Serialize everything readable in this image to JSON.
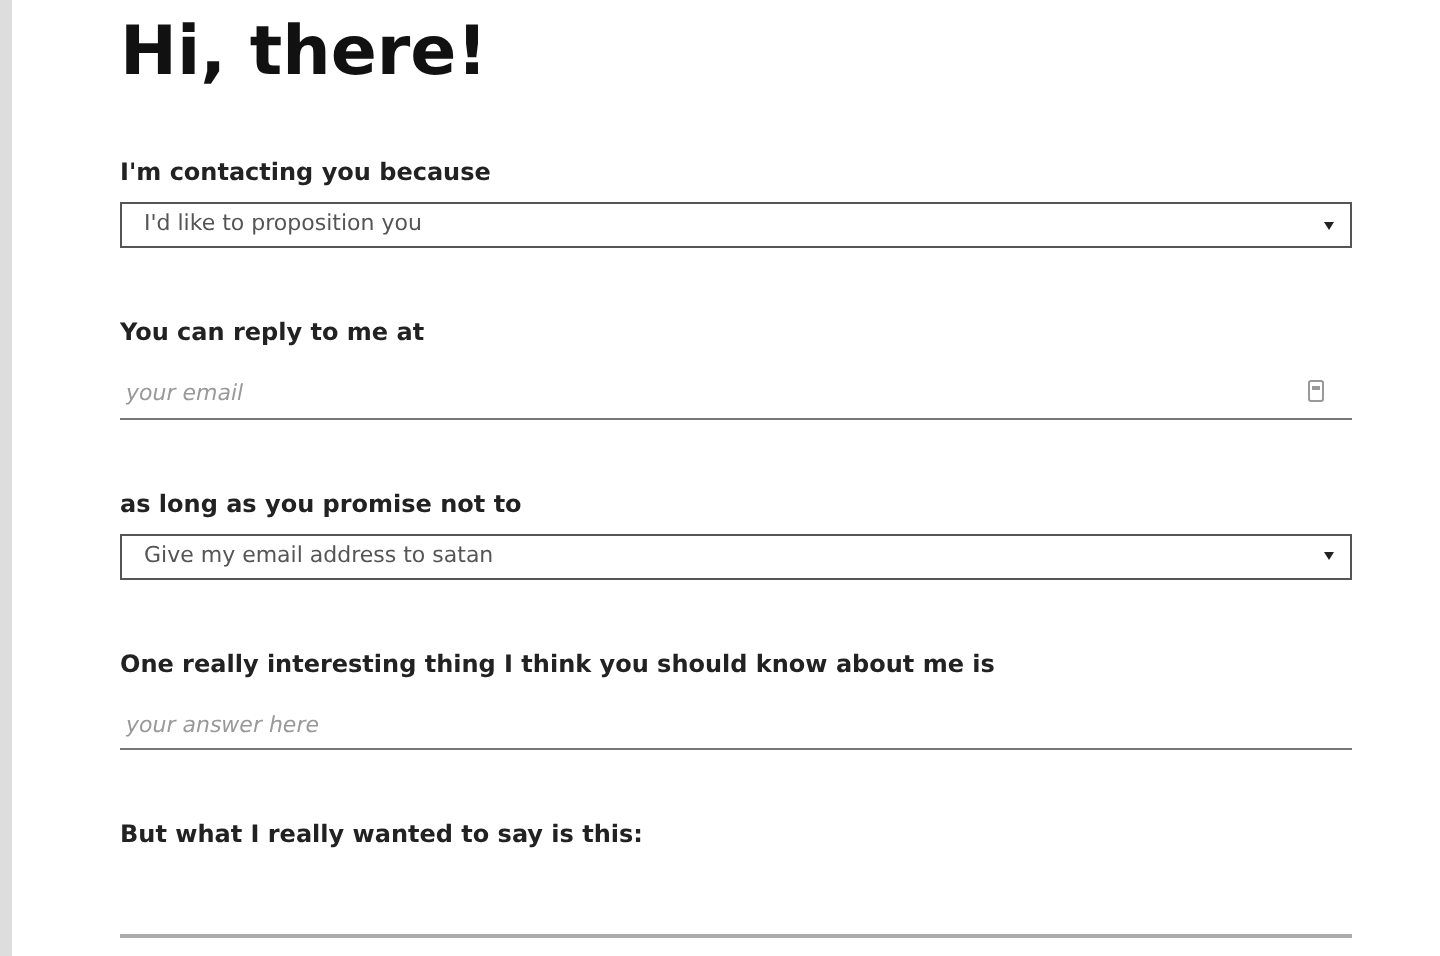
{
  "title": "Hi, there!",
  "fields": [
    {
      "label": "I'm contacting you because",
      "kind": "select",
      "value": "I'd like to proposition you"
    },
    {
      "label": "You can reply to me at",
      "kind": "email",
      "placeholder": "your email"
    },
    {
      "label": "as long as you promise not to",
      "kind": "select",
      "value": "Give my email address to satan"
    },
    {
      "label": "One really interesting thing I think you should know about me is",
      "kind": "text",
      "placeholder": "your answer here"
    },
    {
      "label": "But what I really wanted to say is this:",
      "kind": "blank"
    }
  ]
}
